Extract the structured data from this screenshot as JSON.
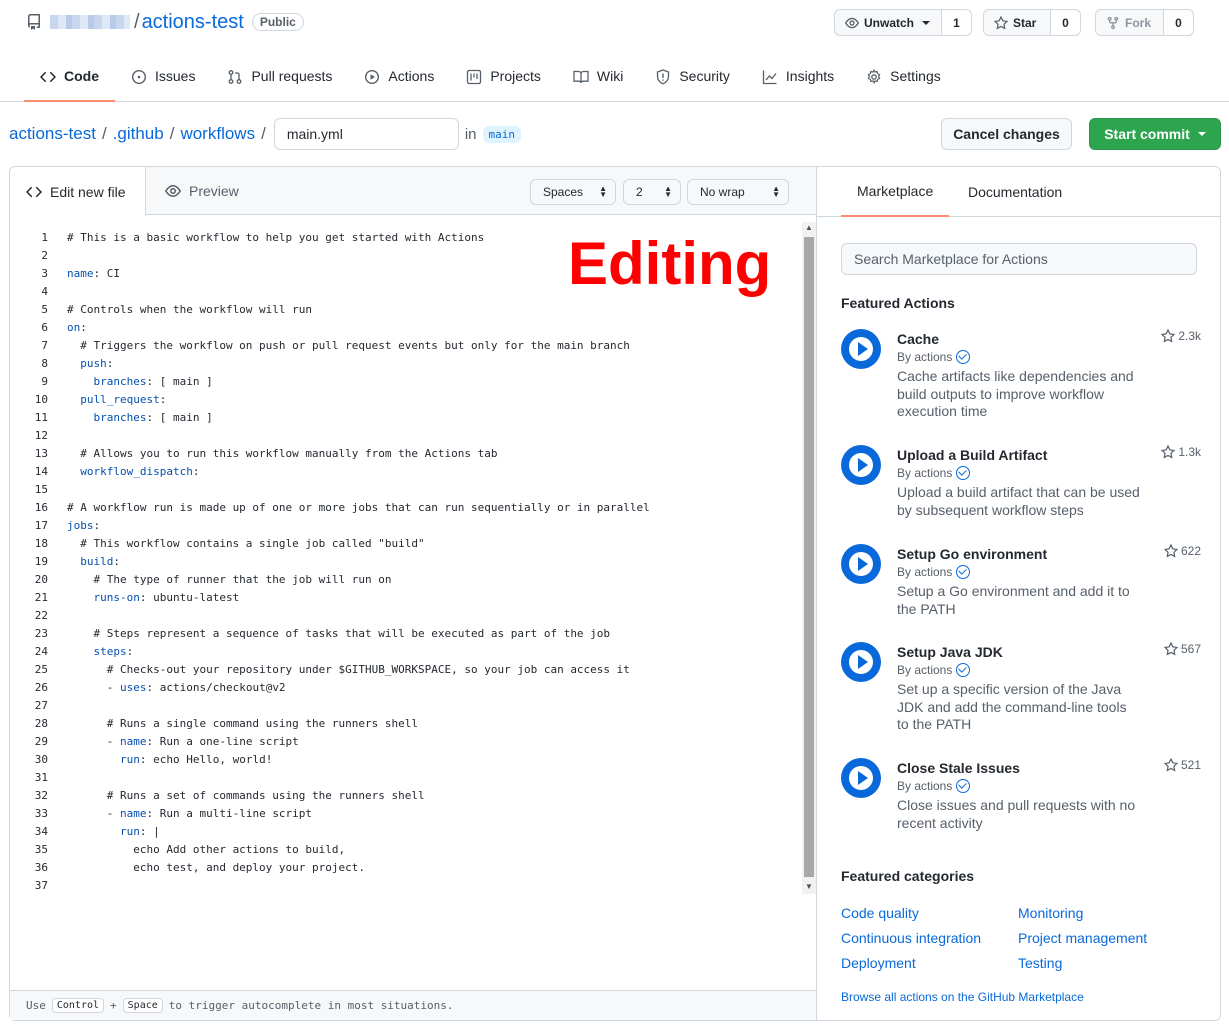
{
  "repo": {
    "name": "actions-test",
    "visibility": "Public"
  },
  "header_buttons": {
    "watch": {
      "label": "Unwatch",
      "count": "1"
    },
    "star": {
      "label": "Star",
      "count": "0"
    },
    "fork": {
      "label": "Fork",
      "count": "0"
    }
  },
  "tabs": [
    {
      "label": "Code",
      "icon": "code-icon"
    },
    {
      "label": "Issues",
      "icon": "issue-icon"
    },
    {
      "label": "Pull requests",
      "icon": "pull-request-icon"
    },
    {
      "label": "Actions",
      "icon": "play-icon"
    },
    {
      "label": "Projects",
      "icon": "project-icon"
    },
    {
      "label": "Wiki",
      "icon": "book-icon"
    },
    {
      "label": "Security",
      "icon": "shield-icon"
    },
    {
      "label": "Insights",
      "icon": "graph-icon"
    },
    {
      "label": "Settings",
      "icon": "gear-icon"
    }
  ],
  "path": {
    "crumbs": [
      "actions-test",
      ".github",
      "workflows"
    ],
    "separator": "/",
    "filename": "main.yml",
    "in_label": "in",
    "branch": "main"
  },
  "buttons": {
    "cancel": "Cancel changes",
    "commit": "Start commit"
  },
  "editor": {
    "tab_edit": "Edit new file",
    "tab_preview": "Preview",
    "indent_mode": "Spaces",
    "indent_size": "2",
    "wrap_mode": "No wrap",
    "overlay_label": "Editing",
    "lines": [
      "# This is a basic workflow to help you get started with Actions",
      "",
      "name: CI",
      "",
      "# Controls when the workflow will run",
      "on:",
      "  # Triggers the workflow on push or pull request events but only for the main branch",
      "  push:",
      "    branches: [ main ]",
      "  pull_request:",
      "    branches: [ main ]",
      "",
      "  # Allows you to run this workflow manually from the Actions tab",
      "  workflow_dispatch:",
      "",
      "# A workflow run is made up of one or more jobs that can run sequentially or in parallel",
      "jobs:",
      "  # This workflow contains a single job called \"build\"",
      "  build:",
      "    # The type of runner that the job will run on",
      "    runs-on: ubuntu-latest",
      "",
      "    # Steps represent a sequence of tasks that will be executed as part of the job",
      "    steps:",
      "      # Checks-out your repository under $GITHUB_WORKSPACE, so your job can access it",
      "      - uses: actions/checkout@v2",
      "",
      "      # Runs a single command using the runners shell",
      "      - name: Run a one-line script",
      "        run: echo Hello, world!",
      "",
      "      # Runs a set of commands using the runners shell",
      "      - name: Run a multi-line script",
      "        run: |",
      "          echo Add other actions to build,",
      "          echo test, and deploy your project.",
      ""
    ],
    "footer": {
      "prefix": "Use",
      "key1": "Control",
      "plus": "+",
      "key2": "Space",
      "suffix": "to trigger autocomplete in most situations."
    }
  },
  "sidebar": {
    "tab_marketplace": "Marketplace",
    "tab_docs": "Documentation",
    "search_placeholder": "Search Marketplace for Actions",
    "featured_actions_title": "Featured Actions",
    "actions": [
      {
        "name": "Cache",
        "by": "By actions",
        "desc": "Cache artifacts like dependencies and build outputs to improve workflow execution time",
        "stars": "2.3k"
      },
      {
        "name": "Upload a Build Artifact",
        "by": "By actions",
        "desc": "Upload a build artifact that can be used by subsequent workflow steps",
        "stars": "1.3k"
      },
      {
        "name": "Setup Go environment",
        "by": "By actions",
        "desc": "Setup a Go environment and add it to the PATH",
        "stars": "622"
      },
      {
        "name": "Setup Java JDK",
        "by": "By actions",
        "desc": "Set up a specific version of the Java JDK and add the command-line tools to the PATH",
        "stars": "567"
      },
      {
        "name": "Close Stale Issues",
        "by": "By actions",
        "desc": "Close issues and pull requests with no recent activity",
        "stars": "521"
      }
    ],
    "featured_categories_title": "Featured categories",
    "categories": [
      "Code quality",
      "Monitoring",
      "Continuous integration",
      "Project management",
      "Deployment",
      "Testing"
    ],
    "browse_link": "Browse all actions on the GitHub Marketplace"
  },
  "colors": {
    "accent": "#0969da",
    "commit_green": "#2da44e",
    "tab_underline": "#fd8c73",
    "overlay_red": "#ff0000"
  }
}
